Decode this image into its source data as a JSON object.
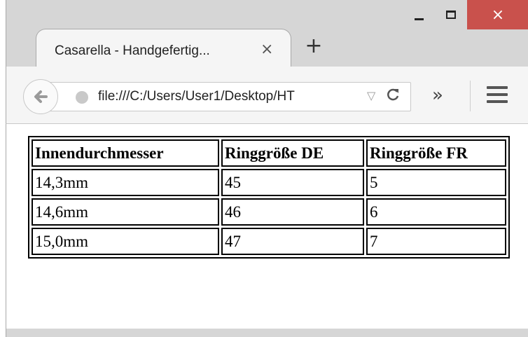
{
  "browser": {
    "tab": {
      "title": "Casarella - Handgefertig...",
      "close_glyph": "×"
    },
    "new_tab_glyph": "+",
    "window_controls": {
      "minimize": "minimize",
      "maximize": "maximize",
      "close_glyph": "×"
    },
    "address_bar": {
      "url": "file:///C:/Users/User1/Desktop/HT",
      "dropdown_glyph": "▽",
      "reload_glyph": "C"
    },
    "overflow_glyph": "»",
    "menu": "hamburger-menu"
  },
  "table": {
    "headers": [
      "Innendurchmesser",
      "Ringgröße DE",
      "Ringgröße FR"
    ],
    "rows": [
      [
        "14,3mm",
        "45",
        "5"
      ],
      [
        "14,6mm",
        "46",
        "6"
      ],
      [
        "15,0mm",
        "47",
        "7"
      ]
    ]
  }
}
